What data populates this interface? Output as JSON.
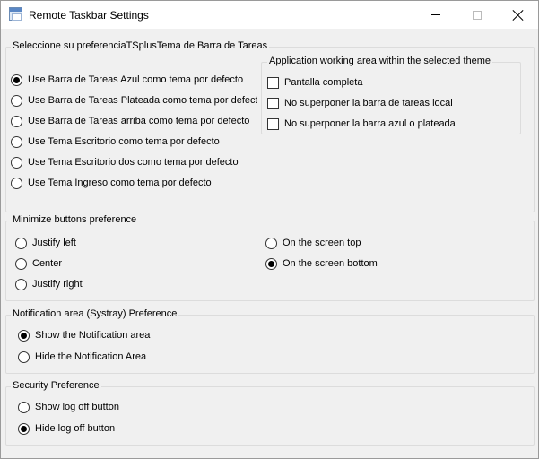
{
  "window": {
    "title": "Remote Taskbar Settings"
  },
  "theme_group": {
    "legend": "Seleccione su preferenciaTSplusTema de Barra de Tareas",
    "options": [
      {
        "label": "Use Barra de Tareas Azul como tema por defecto",
        "selected": true
      },
      {
        "label": "Use Barra de Tareas Plateada como tema por defecto",
        "selected": false
      },
      {
        "label": "Use Barra de Tareas arriba como tema por defecto",
        "selected": false
      },
      {
        "label": "Use Tema Escritorio como tema por defecto",
        "selected": false
      },
      {
        "label": "Use Tema Escritorio dos como tema por defecto",
        "selected": false
      },
      {
        "label": "Use Tema Ingreso como tema por defecto",
        "selected": false
      }
    ]
  },
  "working_area_group": {
    "legend": "Application working area within the selected theme",
    "options": [
      {
        "label": "Pantalla completa",
        "checked": false
      },
      {
        "label": "No superponer la barra de tareas local",
        "checked": false
      },
      {
        "label": "No superponer la barra azul o plateada",
        "checked": false
      }
    ]
  },
  "minimize_group": {
    "legend": "Minimize buttons preference",
    "options": [
      {
        "label": "Justify left",
        "selected": false
      },
      {
        "label": "Center",
        "selected": false
      },
      {
        "label": "Justify right",
        "selected": false
      },
      {
        "label": "On the screen top",
        "selected": false
      },
      {
        "label": "On the screen bottom",
        "selected": true
      }
    ]
  },
  "notification_group": {
    "legend": "Notification area (Systray) Preference",
    "options": [
      {
        "label": "Show the Notification area",
        "selected": true
      },
      {
        "label": "Hide the Notification Area",
        "selected": false
      }
    ]
  },
  "security_group": {
    "legend": "Security Preference",
    "options": [
      {
        "label": "Show log off button",
        "selected": false
      },
      {
        "label": "Hide log off button",
        "selected": true
      }
    ]
  }
}
